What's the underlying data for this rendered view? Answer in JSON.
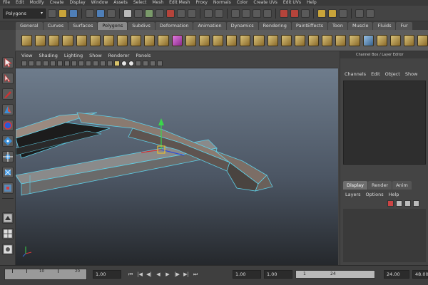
{
  "menubar": [
    "File",
    "Edit",
    "Modify",
    "Create",
    "Display",
    "Window",
    "Assets",
    "Select",
    "Mesh",
    "Edit Mesh",
    "Proxy",
    "Normals",
    "Color",
    "Create UVs",
    "Edit UVs",
    "Help"
  ],
  "status_line": {
    "mode": "Polygons"
  },
  "shelf_tabs": [
    "General",
    "Curves",
    "Surfaces",
    "Polygons",
    "Subdivs",
    "Deformation",
    "Animation",
    "Dynamics",
    "Rendering",
    "PaintEffects",
    "Toon",
    "Muscle",
    "Fluids",
    "Fur"
  ],
  "active_shelf_tab": "Polygons",
  "viewport_menu": [
    "View",
    "Shading",
    "Lighting",
    "Show",
    "Renderer",
    "Panels"
  ],
  "viewport_label": "",
  "channel_box": {
    "title": "Channel Box / Layer Editor",
    "tabs": [
      "Channels",
      "Edit",
      "Object",
      "Show"
    ]
  },
  "layer_editor": {
    "tabs": [
      "Display",
      "Render",
      "Anim"
    ],
    "active_tab": "Display",
    "menu": [
      "Layers",
      "Options",
      "Help"
    ]
  },
  "timeline": {
    "ruler_labels": [
      "10",
      "20"
    ],
    "current_time": "1.00",
    "start_time": "1.00",
    "range_start": "1.00",
    "range_field_a": "1",
    "range_field_b": "24",
    "end_time": "24.00",
    "playback_end": "48.00"
  },
  "colors": {
    "wire_highlight": "#5fd0e8",
    "selection_handle": "#e8c030"
  }
}
